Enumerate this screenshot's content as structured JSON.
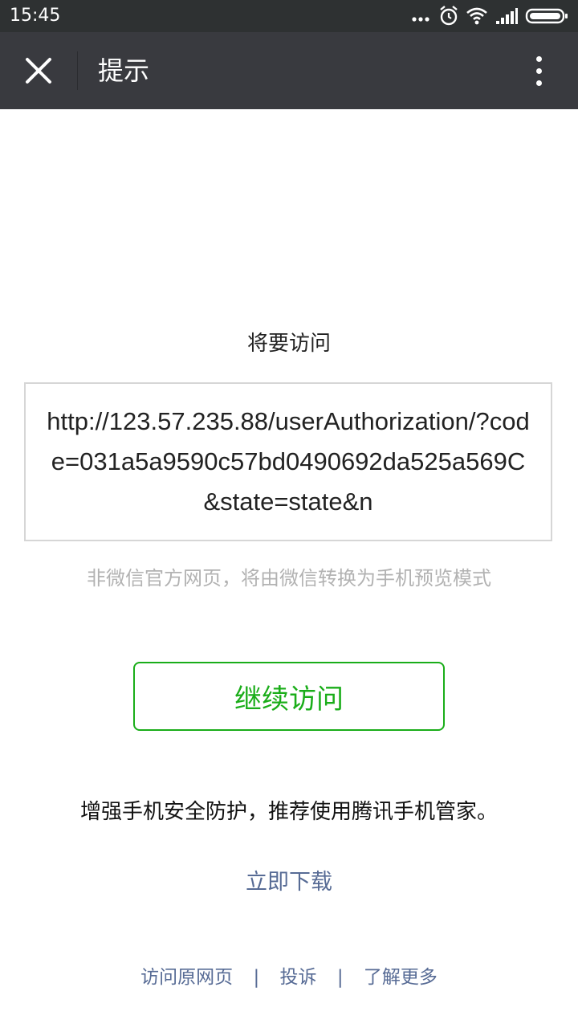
{
  "status_bar": {
    "time": "15:45",
    "icons": [
      "more-dots-icon",
      "alarm-icon",
      "wifi-icon",
      "signal-icon",
      "battery-icon"
    ]
  },
  "title_bar": {
    "title": "提示",
    "close_icon": "close-icon",
    "more_icon": "more-vertical-icon"
  },
  "content": {
    "heading": "将要访问",
    "url": "http://123.57.235.88/userAuthorization/?code=031a5a9590c57bd0490692da525a569C&state=state&n",
    "notice": "非微信官方网页，将由微信转换为手机预览模式",
    "continue_button": "继续访问",
    "promo": "增强手机安全防护，推荐使用腾讯手机管家。",
    "download_link": "立即下载"
  },
  "footer": {
    "links": [
      "访问原网页",
      "投诉",
      "了解更多"
    ],
    "separator": "|"
  },
  "colors": {
    "status_bar_bg": "#2e3132",
    "title_bar_bg": "#393a3f",
    "accent_green": "#1aad19",
    "link_blue": "#576b95",
    "muted_text": "#b2b2b2"
  }
}
